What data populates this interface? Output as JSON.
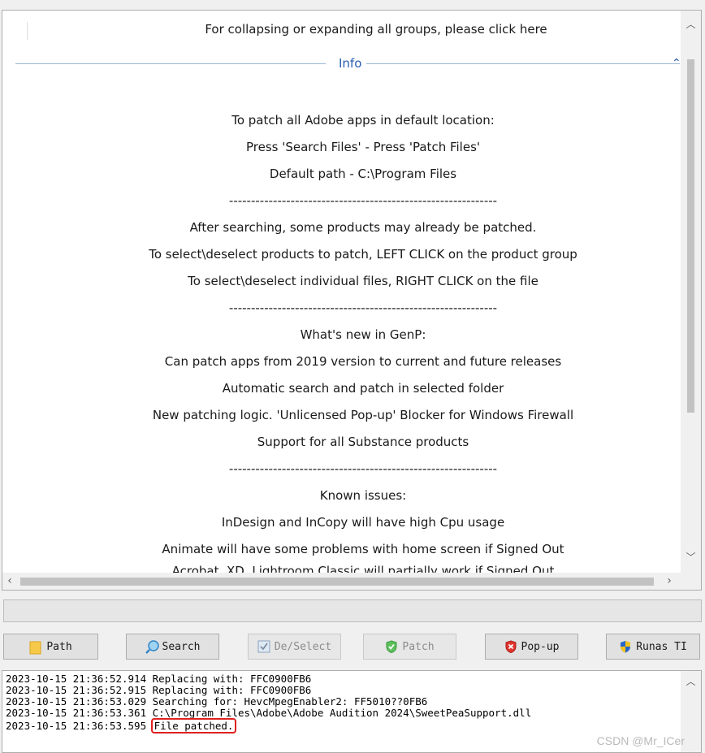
{
  "info_panel": {
    "collapse_hint": "For collapsing or expanding all groups, please click here",
    "group_header": "Info",
    "lines": [
      "To patch all Adobe apps in default location:",
      "Press 'Search Files' - Press 'Patch Files'",
      "Default path - C:\\Program Files",
      "-------------------------------------------------------------",
      "After searching, some products may already be patched.",
      "To select\\deselect products to patch, LEFT CLICK on the product group",
      "To select\\deselect individual files, RIGHT CLICK on the file",
      "-------------------------------------------------------------",
      "What's new in GenP:",
      "Can patch apps from 2019 version to current and future releases",
      "Automatic search and patch in selected folder",
      "New patching logic. 'Unlicensed Pop-up' Blocker for Windows Firewall",
      "Support for all Substance products",
      "-------------------------------------------------------------",
      "Known issues:",
      "InDesign and InCopy will have high Cpu usage",
      "Animate will have some problems with home screen if Signed Out",
      "Acrobat, XD, Lightroom Classic will partially work if Signed Out"
    ]
  },
  "progress": {
    "value": 0
  },
  "toolbar": {
    "path": "Path",
    "search": "Search",
    "deselect": "De/Select",
    "patch": "Patch",
    "popup": "Pop-up",
    "runas": "Runas TI"
  },
  "log": [
    {
      "time": "2023-10-15 21:36:52.914",
      "msg": "Replacing with: FFC0900FB6"
    },
    {
      "time": "2023-10-15 21:36:52.915",
      "msg": "Replacing with: FFC0900FB6"
    },
    {
      "time": "2023-10-15 21:36:53.029",
      "msg": "Searching for: HevcMpegEnabler2: FF5010??0FB6"
    },
    {
      "time": "2023-10-15 21:36:53.361",
      "msg": "C:\\Program Files\\Adobe\\Adobe Audition 2024\\SweetPeaSupport.dll"
    },
    {
      "time": "2023-10-15 21:36:53.595",
      "msg": "File patched."
    }
  ],
  "watermark": "CSDN @Mr_ICer",
  "colors": {
    "accent": "#2a5db0",
    "highlight": "#e02020",
    "panel_bg": "#ffffff",
    "window_bg": "#f0f0f0"
  }
}
